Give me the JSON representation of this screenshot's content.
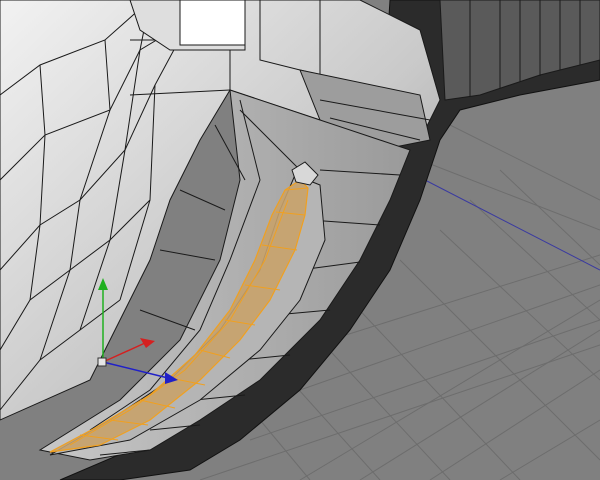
{
  "viewport": {
    "kind": "3d-modeling-perspective-view",
    "colors": {
      "background": "#808080",
      "grid_line": "#6d6d6d",
      "wireframe": "#1a1a1a",
      "selection_fill": "#c8a26a",
      "selection_edge": "#f0a020",
      "axis_x": "#d42020",
      "axis_y": "#20b020",
      "axis_z": "#2020c8",
      "guide_line": "#3a3aa0"
    },
    "gizmo": {
      "icon": "move-axis-gizmo",
      "axes": [
        "x",
        "y",
        "z"
      ]
    },
    "selection": {
      "type": "polygon-strip",
      "state": "selected"
    }
  }
}
